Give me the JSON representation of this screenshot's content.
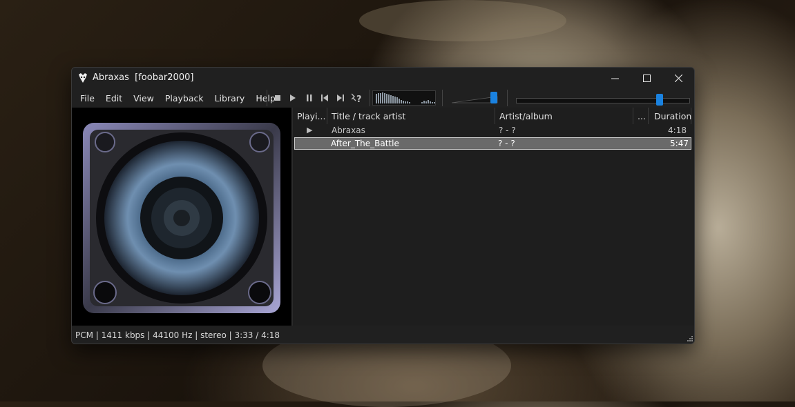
{
  "window": {
    "title": "Abraxas  [foobar2000]"
  },
  "window_controls": {
    "minimize": "—",
    "maximize": "☐",
    "close": "✕"
  },
  "menu": [
    "File",
    "Edit",
    "View",
    "Playback",
    "Library",
    "Help"
  ],
  "toolbar": {
    "buttons": [
      "stop-icon",
      "play-icon",
      "pause-icon",
      "previous-icon",
      "next-icon",
      "random-icon"
    ],
    "volume_fraction": 0.92,
    "seek_fraction": 0.83
  },
  "playlist": {
    "columns": [
      "Playi...",
      "Title / track artist",
      "Artist/album",
      "...",
      "Duration"
    ],
    "rows": [
      {
        "playing": "▶",
        "title": "Abraxas",
        "artist_album": "? - ?",
        "duration": "4:18",
        "selected": false
      },
      {
        "playing": "",
        "title": "After_The_Battle",
        "artist_album": "? - ?",
        "duration": "5:47",
        "selected": true
      }
    ]
  },
  "status_bar": {
    "text": "PCM | 1411 kbps | 44100 Hz | stereo | 3:33 / 4:18"
  },
  "colors": {
    "accent": "#1a82e0",
    "window_bg": "#202020",
    "selection": "#6a6a6a"
  }
}
